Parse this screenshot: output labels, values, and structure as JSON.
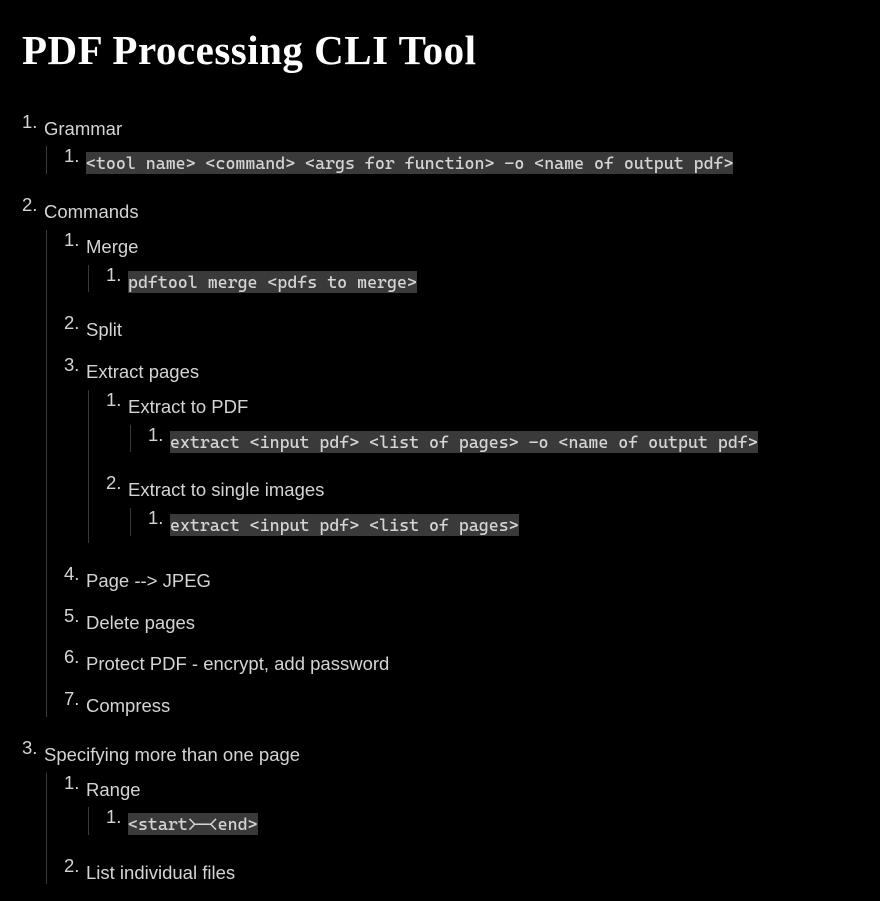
{
  "title": "PDF Processing CLI Tool",
  "outline": {
    "items": [
      {
        "label": "Grammar",
        "children": [
          {
            "code": "<tool name> <command> <args for function> -o <name of output pdf>"
          }
        ]
      },
      {
        "label": "Commands",
        "children": [
          {
            "label": "Merge",
            "children": [
              {
                "code": "pdftool merge <pdfs to merge>"
              }
            ]
          },
          {
            "label": "Split"
          },
          {
            "label": "Extract pages",
            "children": [
              {
                "label": "Extract to PDF",
                "children": [
                  {
                    "code": "extract <input pdf> <list of pages> -o <name of output pdf>"
                  }
                ]
              },
              {
                "label": "Extract to single images",
                "children": [
                  {
                    "code": "extract <input pdf> <list of pages>"
                  }
                ]
              }
            ]
          },
          {
            "label": "Page --> JPEG"
          },
          {
            "label": "Delete pages"
          },
          {
            "label": "Protect PDF - encrypt, add password"
          },
          {
            "label": "Compress"
          }
        ]
      },
      {
        "label": "Specifying more than one page",
        "children": [
          {
            "label": "Range",
            "children": [
              {
                "code": "<start>-<end>"
              }
            ]
          },
          {
            "label": "List individual files"
          }
        ]
      }
    ]
  }
}
